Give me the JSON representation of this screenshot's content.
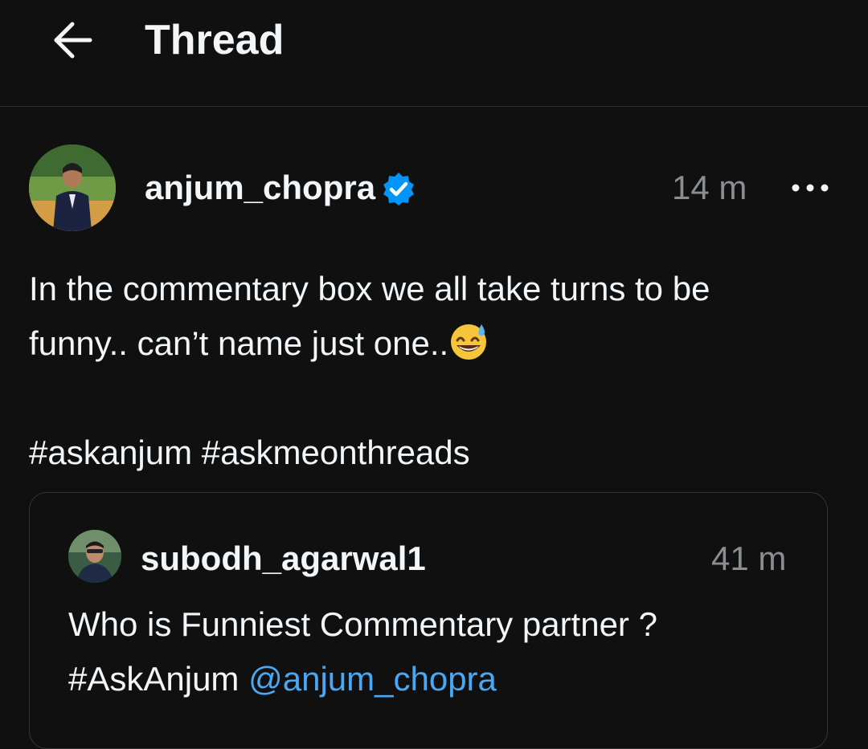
{
  "header": {
    "title": "Thread",
    "back_icon": "arrow-left-icon"
  },
  "post": {
    "username": "anjum_chopra",
    "verified_icon": "verified-badge-icon",
    "time": "14 m",
    "more_icon": "more-horizontal-icon",
    "text_line1": "In the commentary box we all take turns to be",
    "text_line2": "funny.. can’t name just one..",
    "emoji": "grinning-face-with-sweat-emoji",
    "hashtags": [
      "#askanjum",
      "#askmeonthreads"
    ]
  },
  "quoted_post": {
    "username": "subodh_agarwal1",
    "time": "41 m",
    "text_line1": "Who is Funniest Commentary partner ?",
    "hashtag": "#AskAnjum",
    "mention": "@anjum_chopra"
  },
  "colors": {
    "background": "#101010",
    "text": "#f3f5f7",
    "muted": "#8a8d91",
    "link": "#4aa8f3",
    "verified": "#0095f6"
  }
}
